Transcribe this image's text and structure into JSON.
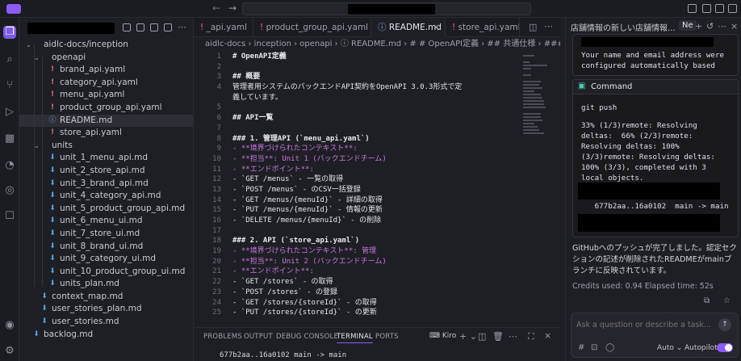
{
  "window": {
    "accent": "#8b5cf6"
  },
  "explorer": {
    "items": [
      {
        "label": "aidlc-docs/inception",
        "type": "folder",
        "depth": 0
      },
      {
        "label": "openapi",
        "type": "folder",
        "depth": 1
      },
      {
        "label": "brand_api.yaml",
        "type": "yaml",
        "depth": 2
      },
      {
        "label": "category_api.yaml",
        "type": "yaml",
        "depth": 2
      },
      {
        "label": "menu_api.yaml",
        "type": "yaml",
        "depth": 2
      },
      {
        "label": "product_group_api.yaml",
        "type": "yaml",
        "depth": 2
      },
      {
        "label": "README.md",
        "type": "info",
        "depth": 2
      },
      {
        "label": "store_api.yaml",
        "type": "yaml",
        "depth": 2
      },
      {
        "label": "units",
        "type": "folder",
        "depth": 1
      },
      {
        "label": "unit_1_menu_api.md",
        "type": "md",
        "depth": 2
      },
      {
        "label": "unit_2_store_api.md",
        "type": "md",
        "depth": 2
      },
      {
        "label": "unit_3_brand_api.md",
        "type": "md",
        "depth": 2
      },
      {
        "label": "unit_4_category_api.md",
        "type": "md",
        "depth": 2
      },
      {
        "label": "unit_5_product_group_api.md",
        "type": "md",
        "depth": 2
      },
      {
        "label": "unit_6_menu_ui.md",
        "type": "md",
        "depth": 2
      },
      {
        "label": "unit_7_store_ui.md",
        "type": "md",
        "depth": 2
      },
      {
        "label": "unit_8_brand_ui.md",
        "type": "md",
        "depth": 2
      },
      {
        "label": "unit_9_category_ui.md",
        "type": "md",
        "depth": 2
      },
      {
        "label": "unit_10_product_group_ui.md",
        "type": "md",
        "depth": 2
      },
      {
        "label": "units_plan.md",
        "type": "md",
        "depth": 2
      },
      {
        "label": "context_map.md",
        "type": "md",
        "depth": 1
      },
      {
        "label": "user_stories_plan.md",
        "type": "md",
        "depth": 1
      },
      {
        "label": "user_stories.md",
        "type": "md",
        "depth": 1
      },
      {
        "label": "backlog.md",
        "type": "md",
        "depth": 0
      }
    ]
  },
  "tabs": [
    {
      "label": "_api.yaml"
    },
    {
      "label": "product_group_api.yaml"
    },
    {
      "label": "README.md"
    },
    {
      "label": "store_api.yaml"
    }
  ],
  "breadcrumb": "aidlc-docs › inception › openapi › ⓘ README.md › # # OpenAPI定義 › ## 共通仕様 › ### エ",
  "code": [
    {
      "n": "1",
      "text": "# OpenAPI定義"
    },
    {
      "n": "2",
      "text": ""
    },
    {
      "n": "3",
      "text": "## 概要"
    },
    {
      "n": "4",
      "text": "管理者用システムのバックエンドAPI契約をOpenAPI 3.0.3形式で定"
    },
    {
      "n": "",
      "text": "義しています。"
    },
    {
      "n": "5",
      "text": ""
    },
    {
      "n": "6",
      "text": "## API一覧"
    },
    {
      "n": "7",
      "text": ""
    },
    {
      "n": "8",
      "text": "### 1. 管理API (`menu_api.yaml`)"
    },
    {
      "n": "9",
      "text": "- **境界づけられたコンテキスト**:"
    },
    {
      "n": "10",
      "text": "- **担当**: Unit 1 (バックエンドチーム)"
    },
    {
      "n": "11",
      "text": "- **エンドポイント**:"
    },
    {
      "n": "12",
      "text": "  - `GET /menus` - 一覧の取得"
    },
    {
      "n": "13",
      "text": "  - `POST /menus` - のCSV一括登録"
    },
    {
      "n": "14",
      "text": "  - `GET /menus/{menuId}` - 詳細の取得"
    },
    {
      "n": "15",
      "text": "  - `PUT /menus/{menuId}` - 情報の更新"
    },
    {
      "n": "16",
      "text": "  - `DELETE /menus/{menuId}` - の削除"
    },
    {
      "n": "17",
      "text": ""
    },
    {
      "n": "18",
      "text": "### 2. API (`store_api.yaml`)"
    },
    {
      "n": "19",
      "text": "- **境界づけられたコンテキスト**: 管理"
    },
    {
      "n": "20",
      "text": "- **担当**: Unit 2 (バックエンドチーム)"
    },
    {
      "n": "21",
      "text": "- **エンドポイント**:"
    },
    {
      "n": "22",
      "text": "  - `GET /stores` - の取得"
    },
    {
      "n": "23",
      "text": "  - `POST /stores` - の登録"
    },
    {
      "n": "24",
      "text": "  - `GET /stores/{storeId}` - の取得"
    },
    {
      "n": "25",
      "text": "  - `PUT /stores/{storeId}` - の更新"
    }
  ],
  "panel": {
    "tabs": [
      "PROBLEMS",
      "OUTPUT",
      "DEBUG CONSOLE",
      "TERMINAL",
      "PORTS"
    ],
    "active_tab": "TERMINAL",
    "shell": "Kiro",
    "output": "677b2aa..16a0102  main -> main"
  },
  "chat": {
    "tab_title": "店舗情報の新しい店舗情報...",
    "tab2": "Ne",
    "top_text": "Your name and email address were\nconfigured automatically based",
    "command_label": "Command",
    "command": "git push",
    "command_output": "33% (1/3)remote: Resolving\ndeltas:  66% (2/3)remote:\nResolving deltas: 100%\n(3/3)remote: Resolving deltas:\n100% (3/3), completed with 3\nlocal objects.",
    "command_result": "   677b2aa..16a0102  main -> main",
    "message": "GitHubへのプッシュが完了しました。認定セクションの記述が削除されたREADMEがmainブランチに反映されています。",
    "credits": "Credits used: 0.94   Elapsed time: 52s",
    "input_placeholder": "Ask a question or describe a task...",
    "model": "Auto",
    "autopilot": "Autopilot"
  }
}
